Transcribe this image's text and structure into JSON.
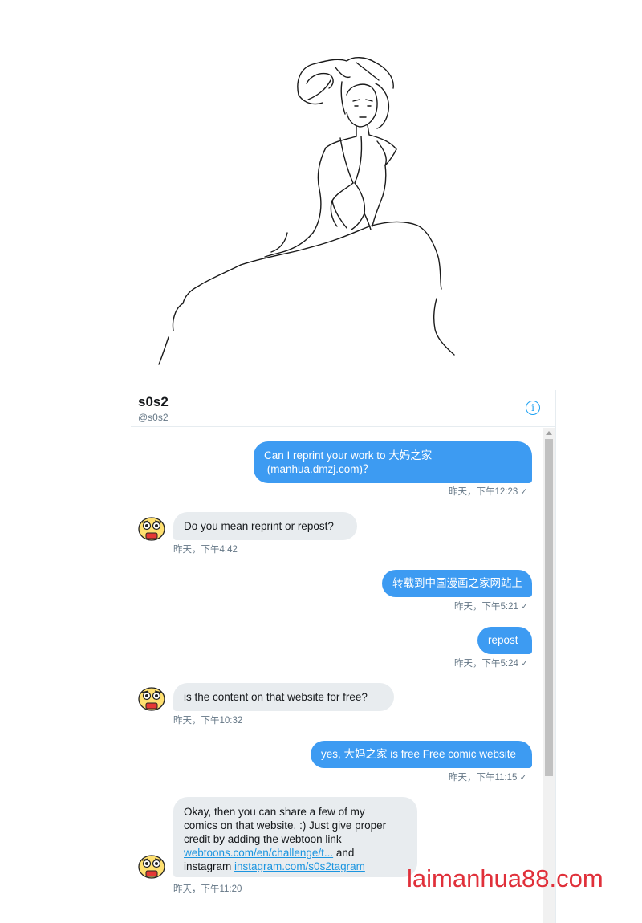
{
  "conversation": {
    "name": "s0s2",
    "handle": "@s0s2",
    "info_icon": "info-icon"
  },
  "messages": [
    {
      "dir": "out",
      "line1": "Can I reprint your work to 大妈之家",
      "link": "manhua.dmzj.com",
      "line2_suffix": "？",
      "time": "昨天，下午12:23"
    },
    {
      "dir": "in",
      "text": "Do you mean reprint or repost?",
      "time": "昨天，下午4:42"
    },
    {
      "dir": "out",
      "text": "转载到中国漫画之家网站上",
      "time": "昨天，下午5:21"
    },
    {
      "dir": "out",
      "text": "repost",
      "time": "昨天，下午5:24"
    },
    {
      "dir": "in",
      "text": "is the content on that website for free?",
      "time": "昨天，下午10:32"
    },
    {
      "dir": "out",
      "text": "yes, 大妈之家 is free Free comic website",
      "time": "昨天，下午11:15"
    },
    {
      "dir": "in",
      "line1": "Okay, then you can share a few of my",
      "line2": "comics on that website. :) Just give proper",
      "line3": "credit by adding the webtoon link",
      "link1": "webtoons.com/en/challenge/t...",
      "and": " and",
      "line5_prefix": "instagram ",
      "link2": "instagram.com/s0s2tagram",
      "time": "昨天，下午11:20"
    }
  ],
  "sent_check": "✓",
  "watermark": "laimanhua88.com",
  "colors": {
    "outgoing": "#3d9bf2",
    "incoming": "#e8ecef",
    "accent": "#1da1f2",
    "watermark": "#e0303a"
  }
}
